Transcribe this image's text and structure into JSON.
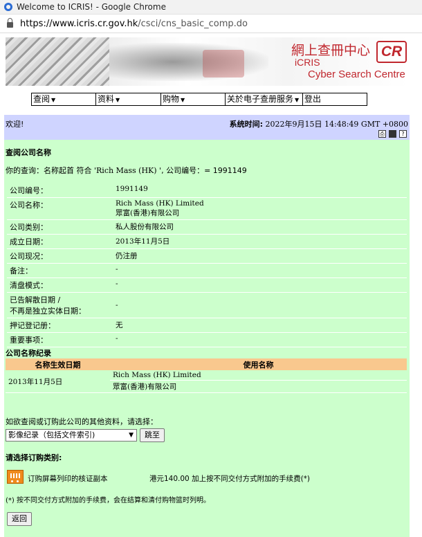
{
  "browser": {
    "title": "Welcome to ICRIS! - Google Chrome",
    "url_host": "https://www.icris.cr.gov.hk",
    "url_path": "/csci/cns_basic_comp.do"
  },
  "banner": {
    "cn": "網上查冊中心",
    "logo": "CR",
    "icris": "iCRIS",
    "tagline": "Cyber Search Centre"
  },
  "menu": {
    "items": [
      "查阅",
      "资料",
      "购物",
      "关於电子查册服务",
      "登出"
    ]
  },
  "welcome": {
    "text": "欢迎!",
    "time_label": "系统时间:",
    "time_value": "2022年9月15日 14:48:49 GMT +0800"
  },
  "section": {
    "title": "查阅公司名称",
    "query_prefix": "你的查询：名称起首 符合 ",
    "query_name": "'Rich Mass (HK) '",
    "query_suffix": ", 公司编号：= 1991149"
  },
  "company": {
    "rows": [
      {
        "label": "公司编号：",
        "value": "1991149"
      },
      {
        "label": "公司名称：",
        "value": "Rich Mass (HK) Limited",
        "value2": "眾富(香港)有限公司"
      },
      {
        "label": "公司类别：",
        "value": "私人股份有限公司"
      },
      {
        "label": "成立日期：",
        "value": "2013年11月5日"
      },
      {
        "label": "公司现况：",
        "value": "仍注册"
      },
      {
        "label": "备注：",
        "value": "-"
      },
      {
        "label": "清盘模式：",
        "value": "-"
      },
      {
        "label": "已告解散日期 /",
        "label2": "不再是独立实体日期：",
        "value": "-"
      },
      {
        "label": "押记登记册：",
        "value": "无"
      },
      {
        "label": "重要事项：",
        "value": "-"
      }
    ]
  },
  "names": {
    "title": "公司名称纪录",
    "col_date": "名称生效日期",
    "col_name": "使用名称",
    "date": "2013年11月5日",
    "name_en": "Rich Mass (HK) Limited",
    "name_cn": "眾富(香港)有限公司"
  },
  "order": {
    "ask": "如欲查阅或订购此公司的其他资料，请选择：",
    "select_value": "影像纪录（包括文件索引)",
    "go_label": "跳至",
    "heading": "请选择订购类别:",
    "item_label": "订购屏幕列印的核证副本",
    "item_price": "港元140.00 加上按不同交付方式附加的手续费(*)",
    "note": "(*) 按不同交付方式附加的手续费，会在结算和清付购物篮时列明。",
    "back_label": "返回"
  }
}
